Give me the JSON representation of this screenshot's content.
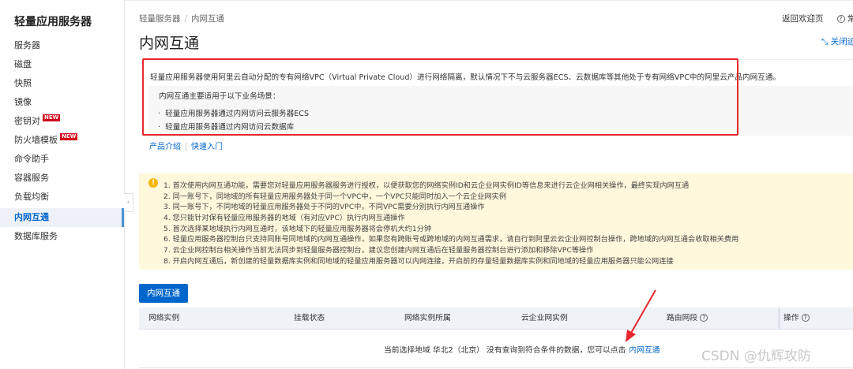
{
  "sidebar": {
    "title": "轻量应用服务器",
    "items": [
      {
        "label": "服务器"
      },
      {
        "label": "磁盘"
      },
      {
        "label": "快照"
      },
      {
        "label": "镜像"
      },
      {
        "label": "密钥对",
        "badge": "NEW"
      },
      {
        "label": "防火墙模板",
        "badge": "NEW"
      },
      {
        "label": "命令助手"
      },
      {
        "label": "容器服务"
      },
      {
        "label": "负载均衡"
      },
      {
        "label": "内网互通",
        "active": true
      },
      {
        "label": "数据库服务"
      }
    ],
    "collapse_icon": "‹"
  },
  "breadcrumb": [
    "轻量服务器",
    "内网互通"
  ],
  "breadcrumb_sep": "/",
  "page_title": "内网互通",
  "header": {
    "back_welcome": "返回欢迎页",
    "help": "常",
    "close_guide": "关闭运"
  },
  "intro": {
    "text": "轻量应用服务器使用阿里云自动分配的专有网络VPC（Virtual Private Cloud）进行网络隔离，默认情况下不与云服务器ECS、云数据库等其他处于专有网络VPC中的阿里云产品内网互通。",
    "scenarios_title": "内网互通主要适用于以下业务场景：",
    "scenarios": [
      "轻量应用服务器通过内网访问云服务器ECS",
      "轻量应用服务器通过内网访问云数据库"
    ],
    "links": [
      "产品介绍",
      "快速入门"
    ]
  },
  "notice": {
    "icon": "!",
    "lines": [
      "1. 首次使用内网互通功能，需要您对轻量应用服务器服务进行授权，以便获取您的网络实例ID和云企业网实例ID等信息来进行云企业网相关操作，最终实现内网互通",
      "2. 同一账号下，同地域的所有轻量应用服务器处于同一个VPC中，一个VPC只能同时加入一个云企业网实例",
      "3. 同一账号下，不同地域的轻量应用服务器处于不同的VPC中，不同VPC需要分别执行内网互通操作",
      "4. 您只能针对保有轻量应用服务器的地域（有对应VPC）执行内网互通操作",
      "5. 首次选择某地域执行内网互通时，该地域下的轻量应用服务器将会停机大约1分钟",
      "6. 轻量应用服务器控制台只支持同账号同地域的内网互通操作，如果您有跨账号或跨地域的内网互通需求，请自行到阿里云云企业网控制台操作，跨地域的内网互通会收取相关费用",
      "7. 云企业网控制台相关操作当前无法同步到轻量服务器控制台，建议您创建内网互通后在轻量服务器控制台进行添加和移除VPC等操作",
      "8. 开启内网互通后，新创建的轻量数据库实例和同地域的轻量应用服务器可以内网连接，开启前的存量轻量数据库实例和同地域的轻量应用服务器只能公网连接"
    ]
  },
  "action_button": "内网互通",
  "table": {
    "columns": [
      "网络实例",
      "挂载状态",
      "网络实例所属",
      "云企业网实例",
      "路由网段",
      "操作"
    ],
    "empty_text": "当前选择地域 华北2（北京） 没有查询到符合条件的数据，您可以点击",
    "empty_link": "内网互通"
  },
  "watermark": "CSDN @仇辉攻防",
  "colors": {
    "accent": "#0066cc",
    "highlight": "#e8262b",
    "notice_bg": "#fff8dc"
  }
}
